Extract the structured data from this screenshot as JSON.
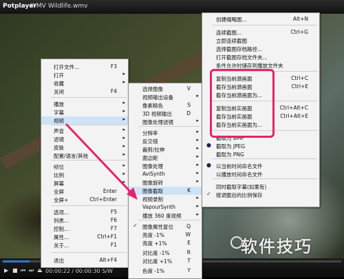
{
  "titlebar": {
    "app": "Potplayer",
    "format": "WMV",
    "filename": "Wildlife.wmv"
  },
  "player": {
    "time": "00:00:22 / 00:00:30",
    "mode": "S/W",
    "progress": 0.08
  },
  "watermark": "软件技巧",
  "menu1": [
    {
      "label": "打开文件...",
      "shortcut": "F3"
    },
    {
      "label": "打开",
      "arrow": true
    },
    {
      "label": "收藏",
      "arrow": true
    },
    {
      "label": "关闭",
      "shortcut": "F4"
    },
    {
      "label": "播放",
      "arrow": true
    },
    {
      "label": "字幕",
      "arrow": true
    },
    {
      "label": "视频",
      "arrow": true
    },
    {
      "label": "声音",
      "arrow": true
    },
    {
      "label": "滤镜",
      "arrow": true
    },
    {
      "label": "皮肤",
      "arrow": true
    },
    {
      "label": "配置/语言/其他",
      "arrow": true
    },
    {
      "label": "帧位",
      "arrow": true
    },
    {
      "label": "比例",
      "arrow": true
    },
    {
      "label": "屏幕",
      "arrow": true
    },
    {
      "label": "全屏",
      "shortcut": "Enter"
    },
    {
      "label": "全屏+",
      "shortcut": "Ctrl+Enter"
    },
    {
      "label": "选项...",
      "shortcut": "F5"
    },
    {
      "label": "列表...",
      "shortcut": "F6"
    },
    {
      "label": "控制...",
      "shortcut": "F7"
    },
    {
      "label": "属性...",
      "shortcut": "Ctrl+F1"
    },
    {
      "label": "关于...",
      "shortcut": "F1"
    },
    {
      "label": "退出",
      "shortcut": "Alt+F4"
    }
  ],
  "menu2": [
    {
      "label": "选择图像",
      "shortcut": "V"
    },
    {
      "label": "视频输出设备"
    },
    {
      "label": "像素精色",
      "shortcut": "S"
    },
    {
      "label": "3D 视频输出",
      "shortcut": "D"
    },
    {
      "label": "图像处理滤镜"
    },
    {
      "label": "分辨率"
    },
    {
      "label": "反交错"
    },
    {
      "label": "裁剪/拉伸"
    },
    {
      "label": "面边距"
    },
    {
      "label": "图像处理"
    },
    {
      "label": "AviSynth"
    },
    {
      "label": "图像旋转"
    },
    {
      "label": "图像截取",
      "shortcut": "K"
    },
    {
      "label": "视频录制"
    },
    {
      "label": "VapourSynth"
    },
    {
      "label": "播放 360 度视频"
    },
    {
      "label": "图像属性复位",
      "shortcut": "Q",
      "check": true
    },
    {
      "label": "亮度 -1%",
      "shortcut": "W"
    },
    {
      "label": "亮度 +1%",
      "shortcut": "E"
    },
    {
      "label": "对比度 -1%",
      "shortcut": "R"
    },
    {
      "label": "对比度 +1%",
      "shortcut": "T"
    },
    {
      "label": "色度 -1%",
      "shortcut": "Y"
    }
  ],
  "menu3": [
    {
      "label": "创建缩略图...",
      "shortcut": "Alt+N"
    },
    {
      "label": "连续截图...",
      "shortcut": "Ctrl+G"
    },
    {
      "label": "立即连续截图"
    },
    {
      "label": "选择截图存档路径..."
    },
    {
      "label": "打开截图存档文件夹..."
    },
    {
      "label": "条件允许时储存到播放文件夹"
    },
    {
      "label": "复制当前源画面",
      "shortcut": "Ctrl+C"
    },
    {
      "label": "截存当前源画面",
      "shortcut": "Ctrl+E"
    },
    {
      "label": "截存当前源画面为..."
    },
    {
      "label": "复制当前实画面",
      "shortcut": "Ctrl+Alt+C"
    },
    {
      "label": "截存当前实画面",
      "shortcut": "Ctrl+Alt+E"
    },
    {
      "label": "截存当前实画面为..."
    },
    {
      "label": "截取为 BMP"
    },
    {
      "label": "截取为 JPEG",
      "radio": true
    },
    {
      "label": "截取为 PNG"
    },
    {
      "label": "以当前时间命名文件",
      "radio": true
    },
    {
      "label": "以播放时间命名文件"
    },
    {
      "label": "同时截取字幕(如果有)"
    },
    {
      "label": "按调整后的比例保存",
      "check": true
    }
  ],
  "colors": {
    "highlight": "#e8216a",
    "progress": "#2b79d8"
  }
}
